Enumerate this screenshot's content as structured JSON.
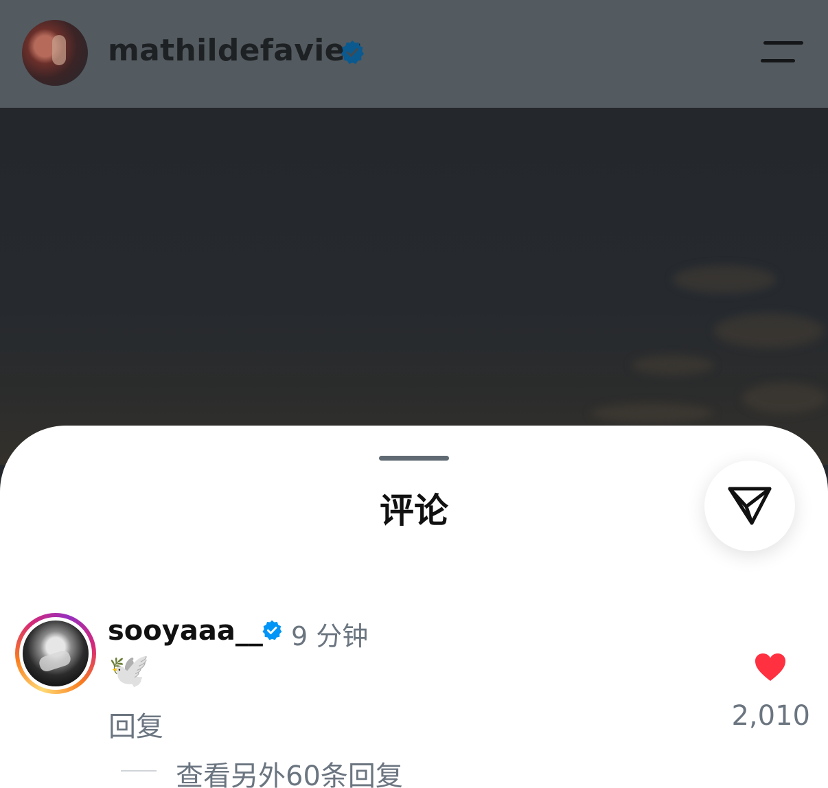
{
  "header": {
    "username": "mathildefavier",
    "verified_icon": "verified-badge-icon",
    "menu_icon": "menu-icon"
  },
  "sheet": {
    "title": "评论",
    "share_icon": "send-icon"
  },
  "comment": {
    "username": "sooyaaa__",
    "time": "9 分钟",
    "text": "🕊️",
    "reply_label": "回复",
    "like_count": "2,010",
    "liked": true,
    "view_replies": "查看另外60条回复"
  },
  "colors": {
    "verified": "#0095f6",
    "like": "#ff3040",
    "secondary_text": "#6b7580"
  }
}
